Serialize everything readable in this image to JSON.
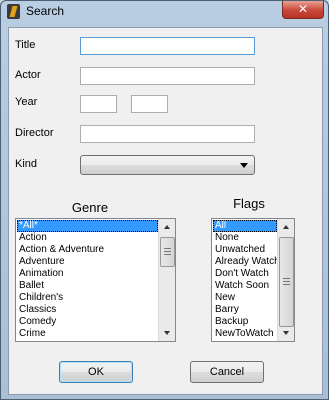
{
  "window": {
    "title": "Search",
    "close_glyph": "✕",
    "icon": "app-icon"
  },
  "form": {
    "title_label": "Title",
    "actor_label": "Actor",
    "year_label": "Year",
    "director_label": "Director",
    "kind_label": "Kind",
    "title_value": "",
    "actor_value": "",
    "year_from_value": "",
    "year_to_value": "",
    "director_value": "",
    "kind_value": ""
  },
  "genre": {
    "heading": "Genre",
    "items": [
      "*All*",
      "Action",
      "Action & Adventure",
      "Adventure",
      "Animation",
      "Ballet",
      "Children's",
      "Classics",
      "Comedy",
      "Crime"
    ],
    "selected_index": 0
  },
  "flags": {
    "heading": "Flags",
    "items": [
      "All",
      "None",
      "Unwatched",
      "Already Watch",
      "Don't Watch",
      "Watch Soon",
      "New",
      "Barry",
      "Backup",
      "NewToWatch"
    ],
    "selected_index": 0
  },
  "buttons": {
    "ok": "OK",
    "cancel": "Cancel"
  },
  "colors": {
    "selection": "#3399ff",
    "focus_border": "#5c9ad6",
    "close_red": "#c8473a"
  }
}
